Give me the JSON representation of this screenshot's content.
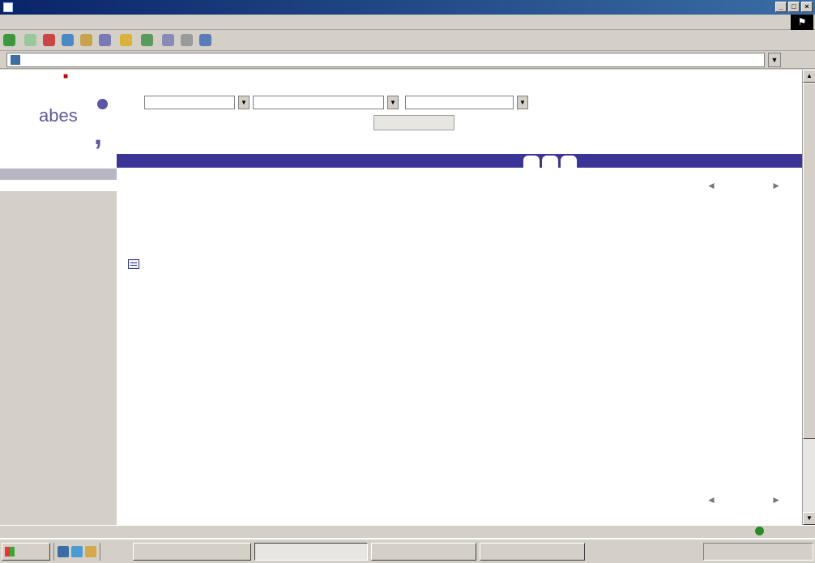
{
  "window": {
    "title": ""
  },
  "menu": {
    "items": [
      "",
      "",
      "",
      ""
    ]
  },
  "toolbar": {
    "back": "",
    "search": "",
    "favorites": "",
    "history": ""
  },
  "address": {
    "label": "",
    "url": "",
    "go": ""
  },
  "site": {
    "top_links": "",
    "right_link": "",
    "logo_text": "abes"
  },
  "search": {
    "index_value": "",
    "field_value": "",
    "op_label": "",
    "op_value": "",
    "button": ""
  },
  "tabs": [
    "",
    "",
    ""
  ],
  "leftnav": [
    "",
    "",
    "",
    ""
  ],
  "record": {
    "line1": "",
    "line2": "",
    "line3": "",
    "line4": "",
    "line5": ""
  },
  "pager": {
    "prev": "",
    "next": ""
  },
  "notice": {
    "heading": ""
  },
  "fields": [
    {
      "label": "",
      "value": ""
    },
    {
      "label": "",
      "value": ""
    },
    {
      "label": "",
      "value": ""
    },
    {
      "label": "",
      "value": ""
    },
    {
      "label": "",
      "value": ""
    },
    {
      "label": "",
      "value": ""
    },
    {
      "label": "",
      "value": ""
    },
    {
      "label": "",
      "value": ""
    },
    {
      "label": "",
      "value": ""
    },
    {
      "label": "",
      "value": ""
    },
    {
      "label": "",
      "value": ""
    }
  ],
  "status": {
    "text": "",
    "zone": ""
  },
  "taskbar": {
    "start": "",
    "tasks": [
      "",
      "",
      "",
      "",
      ""
    ],
    "clock": ""
  },
  "colors": {
    "purple_bar": "#3c3598",
    "link": "#1a1acc",
    "highlight_red": "#cc0000",
    "logo": "#5c55a8"
  }
}
